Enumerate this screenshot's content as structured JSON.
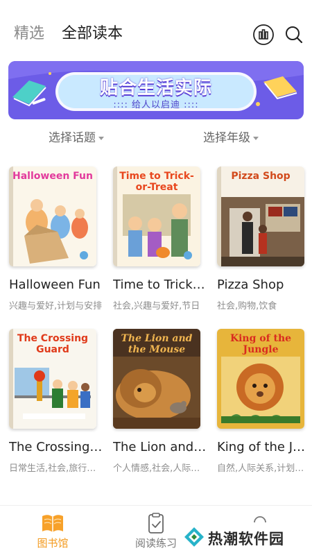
{
  "header": {
    "tabs": [
      {
        "label": "精选",
        "active": false
      },
      {
        "label": "全部读本",
        "active": true
      }
    ],
    "icons": [
      "stats-icon",
      "search-icon"
    ]
  },
  "banner": {
    "title": "贴合生活实际",
    "subtitle": ":::: 给人以启迪 ::::",
    "background": "#6c5ce7"
  },
  "filters": {
    "topic": "选择话题",
    "grade": "选择年级"
  },
  "books": [
    {
      "cover_title": "Halloween Fun",
      "title": "Halloween Fun",
      "tags": "兴趣与爱好,计划与安排",
      "cover_color": "#e23a9c"
    },
    {
      "cover_title": "Time to Trick-or-Treat",
      "title": "Time to Trick-or-Treat",
      "tags": "社会,兴趣与爱好,节日",
      "cover_color": "#e8471e"
    },
    {
      "cover_title": "Pizza Shop",
      "title": "Pizza Shop",
      "tags": "社会,购物,饮食",
      "cover_color": "#d24a1c"
    },
    {
      "cover_title": "The Crossing Guard",
      "title": "The Crossing Guard",
      "tags": "日常生活,社会,旅行与交通",
      "cover_color": "#e03a1a"
    },
    {
      "cover_title": "The Lion and the Mouse",
      "title": "The Lion and the Mouse",
      "tags": "个人情感,社会,人际关系",
      "cover_color": "#f0b550"
    },
    {
      "cover_title": "King of the Jungle",
      "title": "King of the Jungle",
      "tags": "自然,人际关系,计划与安排",
      "cover_color": "#d92b1f"
    }
  ],
  "bottom_nav": {
    "items": [
      {
        "label": "图书馆",
        "active": true
      },
      {
        "label": "阅读练习",
        "active": false
      }
    ],
    "active_color": "#f39a1e"
  },
  "watermark": {
    "text": "热潮软件园"
  }
}
